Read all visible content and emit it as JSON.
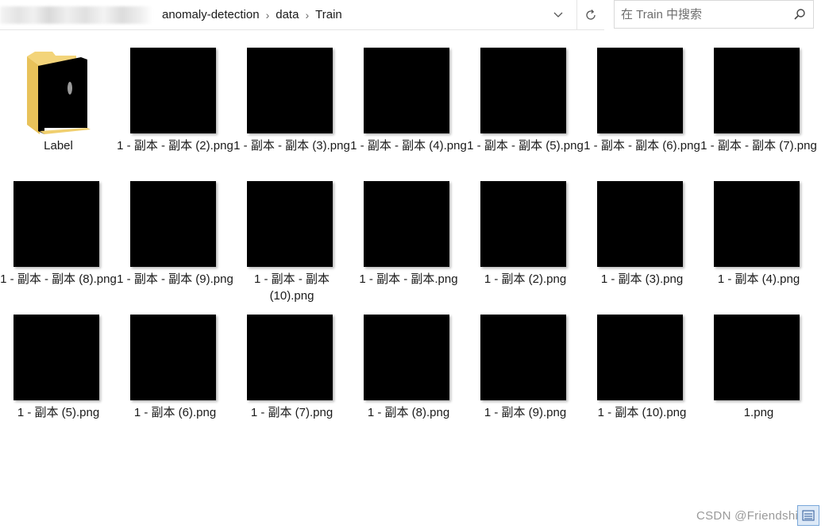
{
  "address": {
    "breadcrumb": [
      "anomaly-detection",
      "data",
      "Train"
    ],
    "separator": "›"
  },
  "search": {
    "placeholder": "在 Train 中搜索",
    "value": ""
  },
  "files": [
    {
      "name": "Label",
      "type": "folder"
    },
    {
      "name": "1 - 副本 - 副本 (2).png",
      "type": "image"
    },
    {
      "name": "1 - 副本 - 副本 (3).png",
      "type": "image"
    },
    {
      "name": "1 - 副本 - 副本 (4).png",
      "type": "image"
    },
    {
      "name": "1 - 副本 - 副本 (5).png",
      "type": "image"
    },
    {
      "name": "1 - 副本 - 副本 (6).png",
      "type": "image"
    },
    {
      "name": "1 - 副本 - 副本 (7).png",
      "type": "image"
    },
    {
      "name": "1 - 副本 - 副本 (8).png",
      "type": "image"
    },
    {
      "name": "1 - 副本 - 副本 (9).png",
      "type": "image"
    },
    {
      "name": "1 - 副本 - 副本 (10).png",
      "type": "image"
    },
    {
      "name": "1 - 副本 - 副本.png",
      "type": "image"
    },
    {
      "name": "1 - 副本 (2).png",
      "type": "image"
    },
    {
      "name": "1 - 副本 (3).png",
      "type": "image"
    },
    {
      "name": "1 - 副本 (4).png",
      "type": "image"
    },
    {
      "name": "1 - 副本 (5).png",
      "type": "image"
    },
    {
      "name": "1 - 副本 (6).png",
      "type": "image"
    },
    {
      "name": "1 - 副本 (7).png",
      "type": "image"
    },
    {
      "name": "1 - 副本 (8).png",
      "type": "image"
    },
    {
      "name": "1 - 副本 (9).png",
      "type": "image"
    },
    {
      "name": "1 - 副本 (10).png",
      "type": "image"
    },
    {
      "name": "1.png",
      "type": "image"
    }
  ],
  "watermark": "CSDN @Friendship运",
  "icons": {
    "dropdown": "chevron-down-icon",
    "refresh": "refresh-icon",
    "search": "search-icon",
    "view": "view-toggle-icon"
  }
}
